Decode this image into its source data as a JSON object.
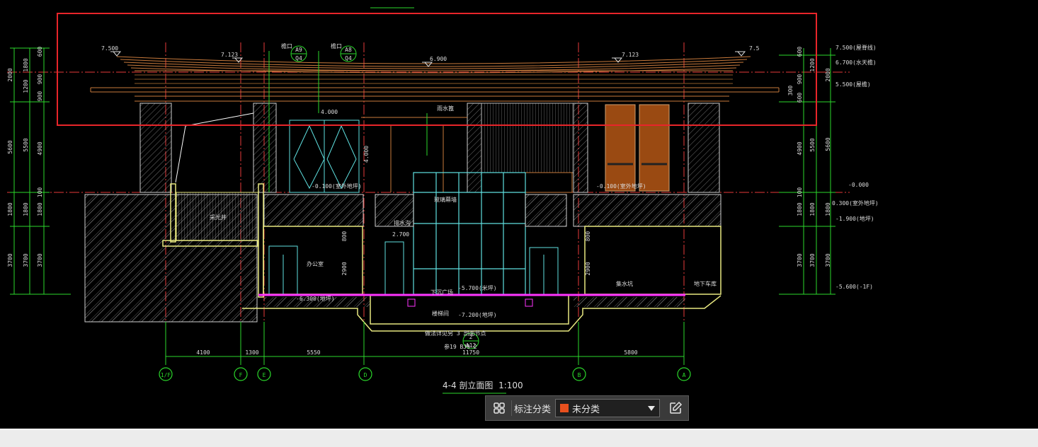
{
  "drawing": {
    "title": "4-4 剖立面图",
    "scale": "1:100",
    "elevation_marks": [
      "7.500",
      "7.123",
      "6.900",
      "7.123",
      "7.5",
      "4.000",
      "4.000",
      "2.700",
      "-0.100(室外地坪)",
      "-0.100(室外地坪)",
      "-5.700(米坪)",
      "-6.300(地坪)",
      "-7.200(地坪)"
    ],
    "right_levels": [
      "7.500(屋脊线)",
      "6.700(水天檐)",
      "5.500(屋檐)",
      "-0.000",
      "0.300(室外地坪)",
      "-1.900(地坪)",
      "-5.600(-1F)"
    ],
    "left_dims_outer": [
      "2000",
      "5600",
      "1800",
      "3700"
    ],
    "left_dims_mid": [
      "1200",
      "5500",
      "1800",
      "3700"
    ],
    "left_dims_inner": [
      "600",
      "1800",
      "900",
      "900",
      "4900",
      "100",
      "1800",
      "3700"
    ],
    "right_dims_outer": [
      "2000",
      "5600",
      "1800",
      "3700"
    ],
    "right_dims_mid": [
      "1200",
      "5500",
      "1800",
      "3700"
    ],
    "right_dims_inner": [
      "600",
      "900",
      "300",
      "600",
      "4900",
      "100",
      "1800",
      "3700"
    ],
    "bottom_dims": [
      "4100",
      "1300",
      "5550",
      "11750",
      "5800"
    ],
    "axes": [
      "1/F",
      "F",
      "E",
      "D",
      "B",
      "A"
    ],
    "tags": [
      {
        "top": "A9",
        "bottom": "Q4"
      },
      {
        "top": "A8",
        "bottom": "Q4"
      },
      {
        "top": "2",
        "bottom": "A12"
      }
    ],
    "small_labels": [
      "玻璃幕墙",
      "雨水篦",
      "采光井",
      "楼梯间",
      "办公室",
      "地下车库",
      "下沉广场",
      "集水坑",
      "排水沟",
      "做法详见另 3 剖面节点",
      "参19 BJ9-2",
      "檐口",
      "檐口"
    ],
    "wall_dims": [
      "800",
      "2900",
      "800",
      "2900"
    ]
  },
  "toolbar": {
    "grid_icon": "grid-four-icon",
    "label": "标注分类",
    "select_value": "未分类",
    "select_color": "#e8501e",
    "edit_icon": "edit-pen-icon"
  },
  "colors": {
    "background": "#000000",
    "highlight": "#e8252a",
    "roof": "#c87a3c",
    "glass": "#5fe0e0",
    "dim": "#2bd82b",
    "axis": "#e63a3a",
    "floor": "#ff33ff",
    "wall": "#e8e880"
  }
}
